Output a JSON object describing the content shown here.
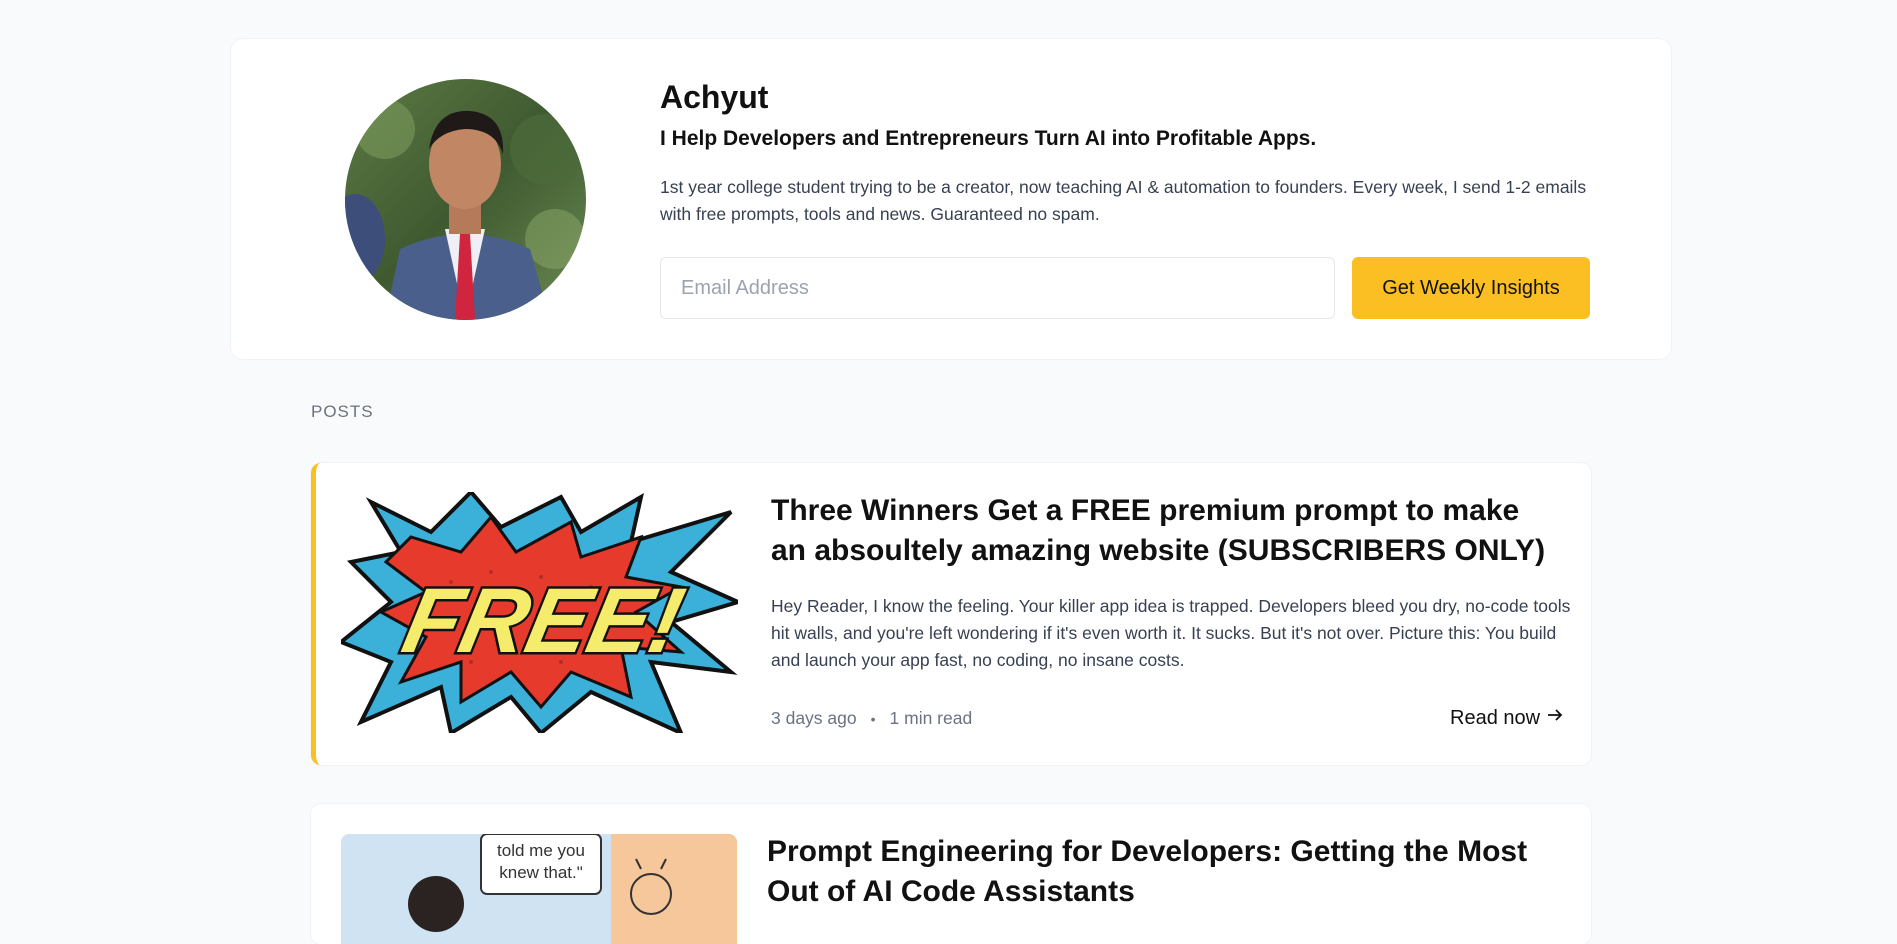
{
  "profile": {
    "name": "Achyut",
    "tagline": "I Help Developers and Entrepreneurs Turn AI into Profitable Apps.",
    "bio": "1st year college student trying to be a creator, now teaching AI & automation to founders. Every week, I send 1-2 emails with free prompts, tools and news. Guaranteed no spam.",
    "email_placeholder": "Email Address",
    "email_value": "",
    "subscribe_label": "Get Weekly Insights"
  },
  "posts_heading": "POSTS",
  "posts": [
    {
      "title": "Three Winners Get a FREE premium prompt to make an absoultely amazing website (SUBSCRIBERS ONLY)",
      "excerpt": "Hey Reader, I know the feeling. Your killer app idea is trapped. Developers bleed you dry, no-code tools hit walls, and you're left wondering if it's even worth it. It sucks. But it's not over. Picture this: You build and launch your app fast, no coding, no insane costs.",
      "date": "3 days ago",
      "separator": "•",
      "read_time": "1 min read",
      "read_label": "Read now",
      "thumb_text": "FREE!"
    },
    {
      "title": "Prompt Engineering for Developers: Getting the Most Out of AI Code Assistants",
      "thumb_text_lines": [
        "told me you",
        "knew that.\""
      ]
    }
  ],
  "colors": {
    "accent": "#fbbf24",
    "background": "#f9fafb",
    "card": "#ffffff"
  },
  "icons": {
    "read_arrow": "arrow-right-icon"
  }
}
